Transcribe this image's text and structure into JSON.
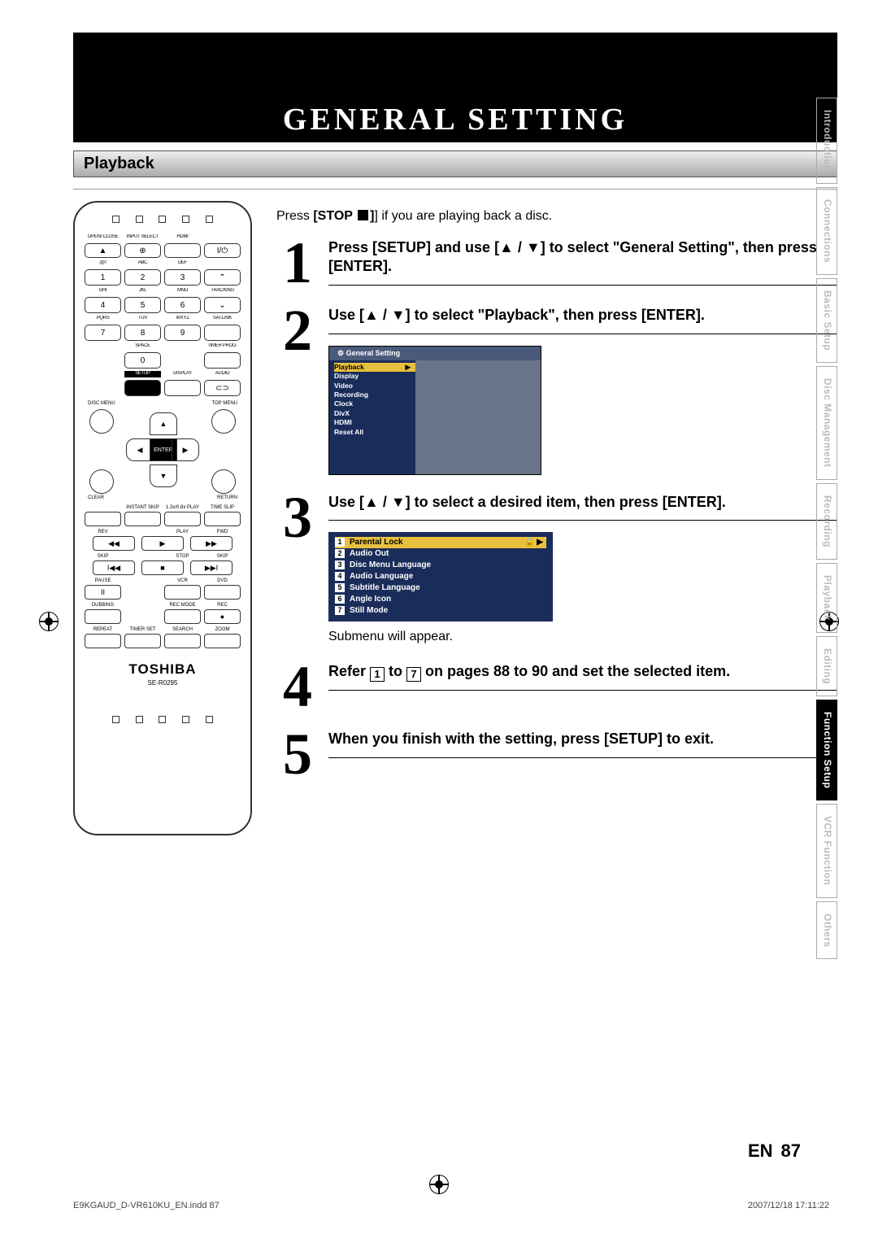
{
  "page": {
    "title": "GENERAL SETTING",
    "section": "Playback",
    "intro_prefix": "Press ",
    "intro_bold": "[STOP ",
    "intro_suffix": "] if you are playing back a disc.",
    "page_lang": "EN",
    "page_number": "87",
    "footer_file": "E9KGAUD_D-VR610KU_EN.indd   87",
    "footer_date": "2007/12/18   17:11:22"
  },
  "remote": {
    "brand": "TOSHIBA",
    "model": "SE-R0295",
    "row1_labels": [
      "OPEN/\nCLOSE",
      "INPUT\nSELECT",
      "HDMI",
      ""
    ],
    "row2_labels": [
      ".@/:",
      "ABC",
      "DEF",
      ""
    ],
    "row2_btns": [
      "1",
      "2",
      "3",
      "⌃"
    ],
    "row3_labels": [
      "GHI",
      "JKL",
      "MNO",
      "TRACKING"
    ],
    "row3_btns": [
      "4",
      "5",
      "6",
      "⌄"
    ],
    "row4_labels": [
      "PQRS",
      "TUV",
      "WXYZ",
      "SAT.LINK"
    ],
    "row4_btns": [
      "7",
      "8",
      "9",
      ""
    ],
    "row5_labels": [
      "",
      "SPACE",
      "",
      "TIMER\nPROG."
    ],
    "row5_btns": [
      "",
      "0",
      "",
      ""
    ],
    "row6_labels": [
      "",
      "SETUP",
      "DISPLAY",
      "AUDIO"
    ],
    "corners": {
      "tl": "DISC MENU",
      "tr": "TOP MENU",
      "bl": "CLEAR",
      "br": "RETURN"
    },
    "enter": "ENTER",
    "transport1_labels": [
      "",
      "INSTANT\nSKIP",
      "1.3x/0.8x\nPLAY",
      "TIME SLIP"
    ],
    "transport2_labels": [
      "REV",
      "PLAY",
      "",
      "FWD"
    ],
    "transport3_labels": [
      "SKIP",
      "STOP",
      "",
      "SKIP"
    ],
    "transport4_labels": [
      "PAUSE",
      "",
      "VCR",
      "DVD"
    ],
    "transport5_labels": [
      "DUBBING",
      "",
      "REC MODE",
      "REC"
    ],
    "bottom_labels": [
      "REPEAT",
      "TIMER SET",
      "SEARCH",
      "ZOOM"
    ]
  },
  "steps": {
    "s1": "Press [SETUP] and use [▲ / ▼] to select \"General Setting\", then press [ENTER].",
    "s2": "Use [▲ / ▼] to select \"Playback\", then press [ENTER].",
    "s3": "Use [▲ / ▼] to select a desired item, then press [ENTER].",
    "s3_caption": "Submenu will appear.",
    "s4_a": "Refer ",
    "s4_b": " to ",
    "s4_c": " on pages 88 to 90 and set the selected item.",
    "s4_n1": "1",
    "s4_n7": "7",
    "s5": "When you finish with the setting, press [SETUP] to exit."
  },
  "menu": {
    "title": "General Setting",
    "items": [
      "Playback",
      "Display",
      "Video",
      "Recording",
      "Clock",
      "DivX",
      "HDMI",
      "Reset All"
    ]
  },
  "submenu": {
    "items": [
      {
        "n": "1",
        "label": "Parental Lock",
        "selected": true
      },
      {
        "n": "2",
        "label": "Audio Out"
      },
      {
        "n": "3",
        "label": "Disc Menu Language"
      },
      {
        "n": "4",
        "label": "Audio Language"
      },
      {
        "n": "5",
        "label": "Subtitle Language"
      },
      {
        "n": "6",
        "label": "Angle Icon"
      },
      {
        "n": "7",
        "label": "Still Mode"
      }
    ]
  },
  "tabs": [
    "Introduction",
    "Connections",
    "Basic Setup",
    "Disc\nManagement",
    "Recording",
    "Playback",
    "Editing",
    "Function Setup",
    "VCR Function",
    "Others"
  ],
  "tabs_active_index": 7
}
